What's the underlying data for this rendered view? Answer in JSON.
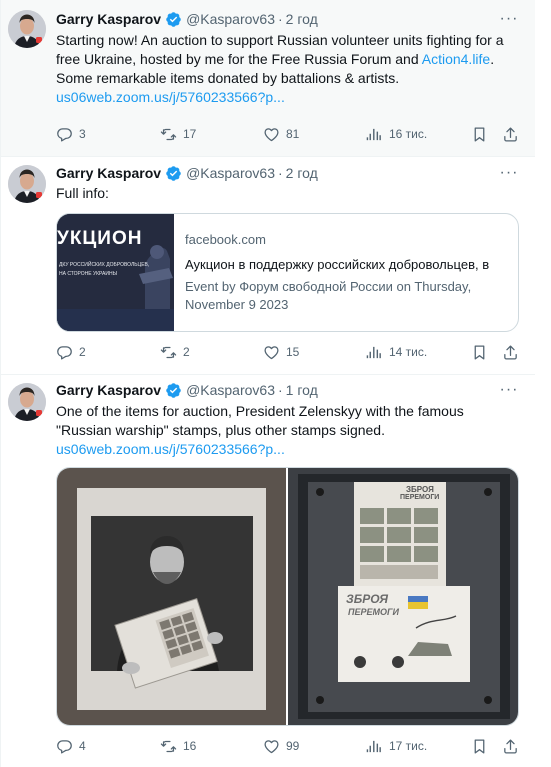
{
  "tweets": [
    {
      "author": "Garry Kasparov",
      "handle": "@Kasparov63",
      "time": "2 год",
      "text": "Starting now! An auction to support Russian volunteer units fighting for a free Ukraine, hosted by me for the Free Russia Forum and ",
      "link_inline": "Action4.life",
      "text_after": ". Some remarkable items donated by battalions & artists.",
      "link_url": "us06web.zoom.us/j/5760233566?p...",
      "replies": "3",
      "retweets": "17",
      "likes": "81",
      "views": "16 тис."
    },
    {
      "author": "Garry Kasparov",
      "handle": "@Kasparov63",
      "time": "2 год",
      "text": "Full info:",
      "card": {
        "image_text": "УКЦИОН",
        "image_subtext_1": "ДКУ РОССИЙСКИХ ДОБРОВОЛЬЦЕВ,",
        "image_subtext_2": "НА СТОРОНЕ УКРАИНЫ",
        "domain": "facebook.com",
        "title": "Аукцион в поддержку российских добровольцев, в",
        "description": "Event by Форум свободной России on Thursday, November 9 2023"
      },
      "replies": "2",
      "retweets": "2",
      "likes": "15",
      "views": "14 тис."
    },
    {
      "author": "Garry Kasparov",
      "handle": "@Kasparov63",
      "time": "1 год",
      "text": "One of the items for auction, President Zelenskyy with the famous \"Russian warship\" stamps, plus other stamps signed.",
      "link_url": "us06web.zoom.us/j/5760233566?p...",
      "stamp_sheet_text_1": "ЗБРОЯ",
      "stamp_sheet_text_2": "ПЕРЕМОГИ",
      "replies": "4",
      "retweets": "16",
      "likes": "99",
      "views": "17 тис."
    }
  ],
  "icons": {
    "verified": "verified-badge-icon",
    "more": "more-icon",
    "reply": "reply-icon",
    "retweet": "retweet-icon",
    "like": "like-icon",
    "views": "views-icon",
    "share": "share-icon"
  },
  "colors": {
    "accent": "#1d9bf0",
    "secondary_text": "#536471",
    "border": "#cfd9de"
  },
  "dot": "·",
  "more_glyph": "···"
}
